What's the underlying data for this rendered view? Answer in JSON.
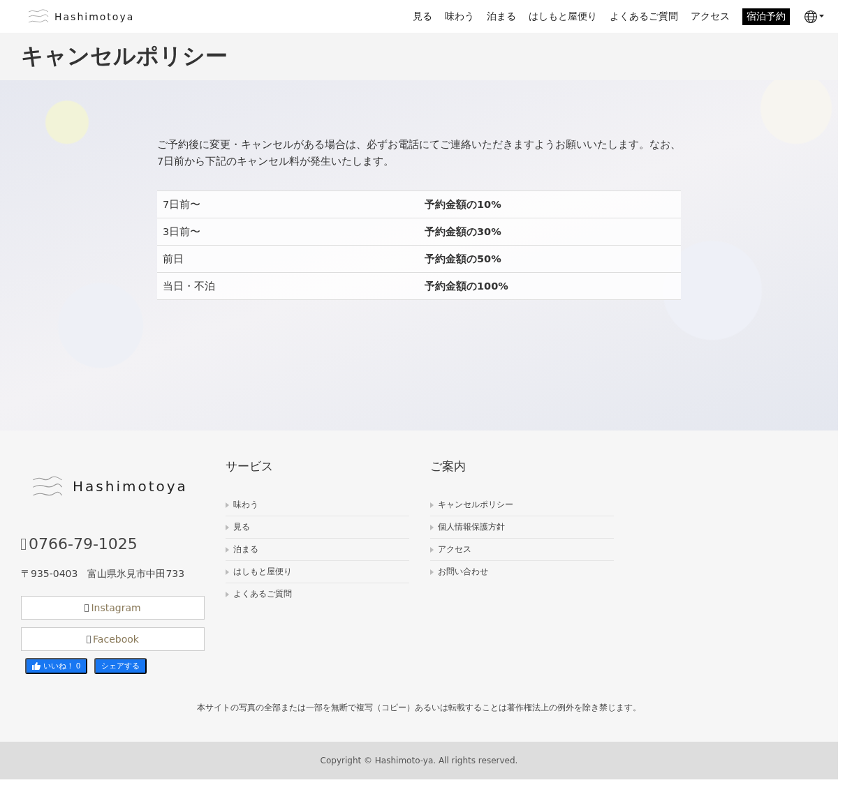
{
  "header": {
    "logo": "Hashimotoya",
    "nav": [
      {
        "label": "見る",
        "kind": "link"
      },
      {
        "label": "味わう",
        "kind": "link"
      },
      {
        "label": "泊まる",
        "kind": "link"
      },
      {
        "label": "はしもと屋便り",
        "kind": "link"
      },
      {
        "label": "よくあるご質問",
        "kind": "link"
      },
      {
        "label": "アクセス",
        "kind": "link"
      },
      {
        "label": "宿泊予約",
        "kind": "cta"
      }
    ]
  },
  "page_title": "キャンセルポリシー",
  "intro": "ご予約後に変更・キャンセルがある場合は、必ずお電話にてご連絡いただきますようお願いいたします。なお、7日前から下記のキャンセル料が発生いたします。",
  "fee_table": {
    "rows": [
      {
        "timing": "7日前〜",
        "fee": "予約金額の10%"
      },
      {
        "timing": "3日前〜",
        "fee": "予約金額の30%"
      },
      {
        "timing": "前日",
        "fee": "予約金額の50%"
      },
      {
        "timing": "当日・不泊",
        "fee": "予約金額の100%"
      }
    ]
  },
  "footer": {
    "logo": "Hashimotoya",
    "phone": "0766-79-1025",
    "address": "〒935-0403　富山県氷見市中田733",
    "social_buttons": [
      "Instagram",
      "Facebook"
    ],
    "like_button": {
      "label": "いいね！",
      "count": "0"
    },
    "share_button": "シェアする",
    "columns": [
      {
        "heading": "サービス",
        "links": [
          "味わう",
          "見る",
          "泊まる",
          "はしもと屋便り",
          "よくあるご質問"
        ]
      },
      {
        "heading": "ご案内",
        "links": [
          "キャンセルポリシー",
          "個人情報保護方針",
          "アクセス",
          "お問い合わせ"
        ]
      }
    ],
    "notice": "本サイトの写真の全部または一部を無断で複写（コピー）あるいは転載することは著作権法上の例外を除き禁じます。",
    "copyright": "Copyright © Hashimoto-ya. All rights reserved."
  }
}
